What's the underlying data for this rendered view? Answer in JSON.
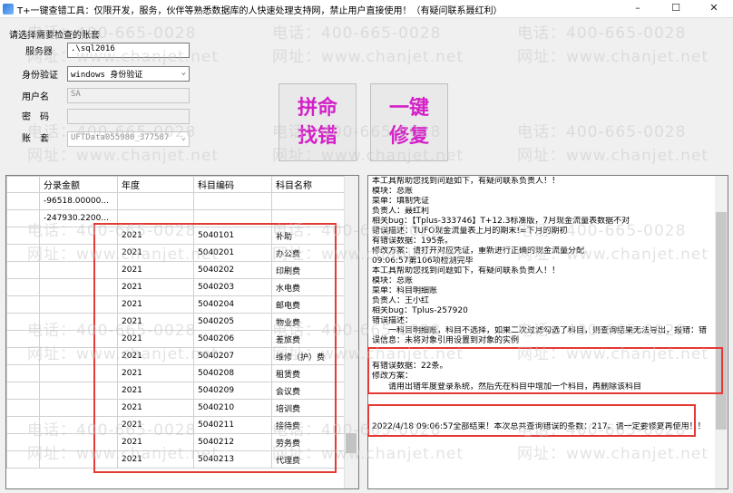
{
  "window": {
    "title": "T+一键查错工具：仅限开发，服务，伙伴等熟悉数据库的人快速处理支持网，禁止用户直接使用！（有疑问联系聂红利）",
    "min_glyph": "–",
    "max_glyph": "☐",
    "close_glyph": "✕"
  },
  "connection": {
    "group_label": "请选择需要检查的账套",
    "server_label": "服务器",
    "server_value": ".\\sql2016",
    "auth_label": "身份验证",
    "auth_value": "windows 身份验证",
    "user_label": "用户名",
    "user_value": "SA",
    "password_label": "密　码",
    "password_value": "",
    "account_label": "账　套",
    "account_value": "UFTData055980_377587"
  },
  "buttons": {
    "find_errors": "拼命\n找错",
    "one_key_fix": "一键\n修复"
  },
  "grid": {
    "headers": [
      "",
      "分录金额",
      "年度",
      "科目编码",
      "科目名称"
    ],
    "rows": [
      [
        "",
        "-96518.00000...",
        "",
        "",
        ""
      ],
      [
        "",
        "-247930.2200...",
        "",
        "",
        ""
      ],
      [
        "",
        "",
        "2021",
        "5040101",
        "补助"
      ],
      [
        "",
        "",
        "2021",
        "5040201",
        "办公费"
      ],
      [
        "",
        "",
        "2021",
        "5040202",
        "印刷费"
      ],
      [
        "",
        "",
        "2021",
        "5040203",
        "水电费"
      ],
      [
        "",
        "",
        "2021",
        "5040204",
        "邮电费"
      ],
      [
        "",
        "",
        "2021",
        "5040205",
        "物业费"
      ],
      [
        "",
        "",
        "2021",
        "5040206",
        "差旅费"
      ],
      [
        "",
        "",
        "2021",
        "5040207",
        "维修（护）费"
      ],
      [
        "",
        "",
        "2021",
        "5040208",
        "租赁费"
      ],
      [
        "",
        "",
        "2021",
        "5040209",
        "会议费"
      ],
      [
        "",
        "",
        "2021",
        "5040210",
        "培训费"
      ],
      [
        "",
        "",
        "2021",
        "5040211",
        "接待费"
      ],
      [
        "",
        "",
        "2021",
        "5040212",
        "劳务费"
      ],
      [
        "",
        "",
        "2021",
        "5040213",
        "代理费"
      ]
    ]
  },
  "log": {
    "lines": [
      "本工具帮助您找到问题如下，有疑问联系负责人！！",
      "模块：总账",
      "菜单：填制凭证",
      "负责人：聂红利",
      "相关bug：【Tplus-333746】T+12.3标准版，7月现金流量表数据不对",
      "错误描述：TUFO现金流量表上月的期末!=下月的期初",
      "有错误数据：195条。",
      "修改方案：请打开对应凭证，重新进行正确的现金流量分配",
      "09:06:57第106项检测完毕",
      "本工具帮助您找到问题如下，有疑问联系负责人！！",
      "模块：总账",
      "菜单：科目明细账",
      "负责人：王小红",
      "相关bug：Tplus-257920",
      "错误描述："
    ],
    "desc_para": "　　一科目明细账，科目不选择，如果二次过滤勾选了科目，则查询结果无法导出，报错：错误信息：未将对象引用设置到对象的实例",
    "count_line": "有错误数据：22条。",
    "fix_label": "修改方案：",
    "fix_para": "　　请用出错年度登录系统，然后先在科目中增加一个科目，再删除该科目",
    "final_para": "2022/4/18 09:06:57全部结束！本次总共查询错误的条数：217。请一定要修复再使用！！"
  },
  "watermark": {
    "phone": "电话：400-665-0028",
    "site": "网址：www.chanjet.net"
  },
  "colors": {
    "button_text": "#d420c8",
    "highlight": "#e53935"
  }
}
